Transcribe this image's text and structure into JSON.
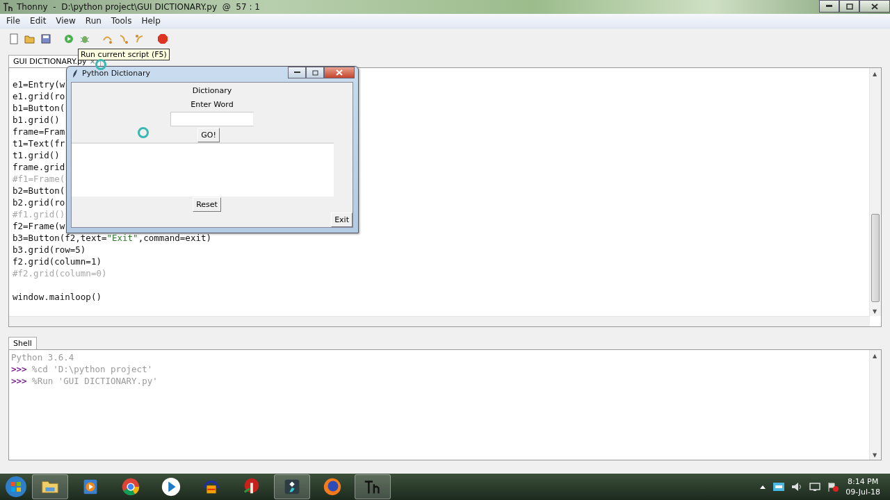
{
  "window": {
    "title": "Thonny  -  D:\\python project\\GUI DICTIONARY.py  @  57 : 1"
  },
  "menu": [
    {
      "label": "File"
    },
    {
      "label": "Edit"
    },
    {
      "label": "View"
    },
    {
      "label": "Run"
    },
    {
      "label": "Tools"
    },
    {
      "label": "Help"
    }
  ],
  "toolbar": {
    "buttons": [
      {
        "kind": "new"
      },
      {
        "kind": "open"
      },
      {
        "kind": "save"
      },
      {
        "kind": "run"
      },
      {
        "kind": "debug"
      },
      {
        "kind": "step-over"
      },
      {
        "kind": "step-into"
      },
      {
        "kind": "step-out"
      },
      {
        "kind": "stop"
      }
    ],
    "tooltip": "Run current script (F5)"
  },
  "editor": {
    "tab": {
      "label": "GUI DICTIONARY.py",
      "close": "×"
    },
    "lines": [
      {
        "parts": [
          {
            "kind": "code",
            "text": "e1=Entry(w"
          }
        ]
      },
      {
        "parts": [
          {
            "kind": "code",
            "text": "e1.grid(ro"
          }
        ]
      },
      {
        "parts": [
          {
            "kind": "code",
            "text": "b1=Button("
          }
        ]
      },
      {
        "parts": [
          {
            "kind": "code",
            "text": "b1.grid()"
          }
        ]
      },
      {
        "parts": [
          {
            "kind": "code",
            "text": "frame=Fram"
          }
        ]
      },
      {
        "parts": [
          {
            "kind": "code",
            "text": "t1=Text(fr"
          }
        ]
      },
      {
        "parts": [
          {
            "kind": "code",
            "text": "t1.grid()"
          }
        ]
      },
      {
        "parts": [
          {
            "kind": "code",
            "text": "frame.grid"
          }
        ]
      },
      {
        "parts": [
          {
            "kind": "comment",
            "text": "#f1=Frame("
          }
        ]
      },
      {
        "parts": [
          {
            "kind": "code",
            "text": "b2=Button("
          }
        ]
      },
      {
        "parts": [
          {
            "kind": "code",
            "text": "b2.grid(ro"
          }
        ]
      },
      {
        "parts": [
          {
            "kind": "comment",
            "text": "#f1.grid()"
          }
        ]
      },
      {
        "parts": [
          {
            "kind": "code",
            "text": "f2=Frame(w"
          }
        ]
      },
      {
        "parts": [
          {
            "kind": "code",
            "text": "b3=Button(f2,text="
          },
          {
            "kind": "string",
            "text": "\"Exit\""
          },
          {
            "kind": "code",
            "text": ",command=exit)"
          }
        ]
      },
      {
        "parts": [
          {
            "kind": "code",
            "text": "b3.grid(row=5)"
          }
        ]
      },
      {
        "parts": [
          {
            "kind": "code",
            "text": "f2.grid(column=1)"
          }
        ]
      },
      {
        "parts": [
          {
            "kind": "comment",
            "text": "#f2.grid(column=0)"
          }
        ]
      },
      {
        "blank": true
      },
      {
        "parts": [
          {
            "kind": "code",
            "text": "window.mainloop()"
          }
        ]
      }
    ]
  },
  "scroll_arrows": {
    "up": "▲",
    "down": "▼"
  },
  "dialog": {
    "title": "Python Dictionary",
    "heading": "Dictionary",
    "prompt": "Enter Word",
    "go": "GO!",
    "reset": "Reset",
    "exit": "Exit"
  },
  "shell": {
    "tab": "Shell",
    "lines": [
      {
        "parts": [
          {
            "kind": "output",
            "text": "Python 3.6.4"
          }
        ]
      },
      {
        "parts": [
          {
            "kind": "prompt",
            "text": ">>>"
          },
          {
            "kind": "output",
            "text": " %cd 'D:\\python project'"
          }
        ]
      },
      {
        "parts": [
          {
            "kind": "prompt",
            "text": ">>>"
          },
          {
            "kind": "output",
            "text": " %Run 'GUI DICTIONARY.py'"
          }
        ]
      }
    ]
  },
  "taskbar": {
    "items": [
      {
        "kind": "explorer",
        "open": true
      },
      {
        "kind": "media",
        "open": false
      },
      {
        "kind": "chrome",
        "open": false
      },
      {
        "kind": "player",
        "open": false
      },
      {
        "kind": "audio",
        "open": false
      },
      {
        "kind": "red-app",
        "open": false
      },
      {
        "kind": "editor",
        "open": true
      },
      {
        "kind": "firefox",
        "open": false
      },
      {
        "kind": "thonny",
        "open": true
      }
    ],
    "time": "8:14 PM",
    "date": "09-Jul-18"
  }
}
